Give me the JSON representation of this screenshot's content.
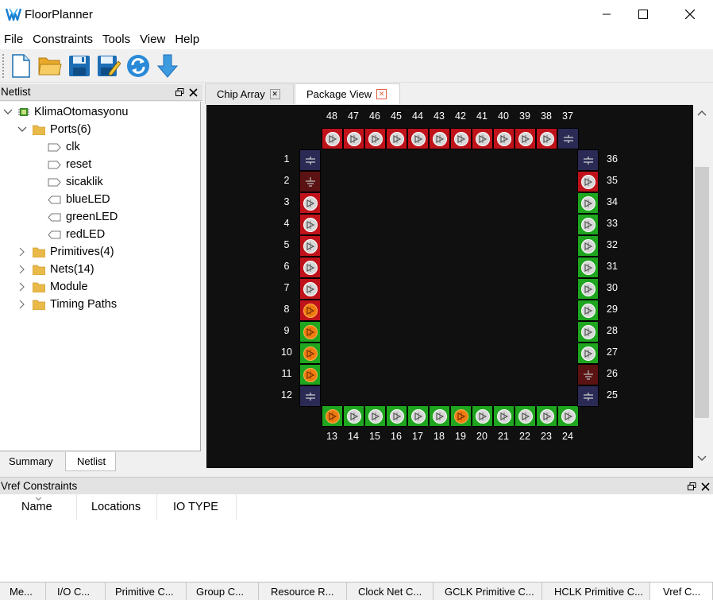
{
  "window": {
    "title": "FloorPlanner",
    "minimize_icon": "minimize-icon",
    "maximize_icon": "maximize-icon",
    "close_icon": "close-icon"
  },
  "menu": [
    "File",
    "Constraints",
    "Tools",
    "View",
    "Help"
  ],
  "toolbar": [
    {
      "name": "new-file-icon"
    },
    {
      "name": "open-folder-icon"
    },
    {
      "name": "save-icon"
    },
    {
      "name": "save-as-icon"
    },
    {
      "name": "refresh-icon"
    },
    {
      "name": "download-arrow-icon"
    }
  ],
  "netlist_panel": {
    "title": "Netlist",
    "root": "KlimaOtomasyonu",
    "ports_label": "Ports(6)",
    "ports": [
      "clk",
      "reset",
      "sicaklik",
      "blueLED",
      "greenLED",
      "redLED"
    ],
    "groups": [
      "Primitives(4)",
      "Nets(14)",
      "Module",
      "Timing Paths"
    ],
    "tabs": [
      "Summary",
      "Netlist"
    ]
  },
  "editor_tabs": [
    "Chip Array",
    "Package View"
  ],
  "package": {
    "top_pins": [
      {
        "num": "48",
        "type": "io",
        "color": "#c0121a"
      },
      {
        "num": "47",
        "type": "io",
        "color": "#c0121a"
      },
      {
        "num": "46",
        "type": "io",
        "color": "#c0121a"
      },
      {
        "num": "45",
        "type": "io",
        "color": "#c0121a"
      },
      {
        "num": "44",
        "type": "io",
        "color": "#c0121a"
      },
      {
        "num": "43",
        "type": "io",
        "color": "#c0121a"
      },
      {
        "num": "42",
        "type": "io",
        "color": "#c0121a"
      },
      {
        "num": "41",
        "type": "io",
        "color": "#c0121a"
      },
      {
        "num": "40",
        "type": "io",
        "color": "#c0121a"
      },
      {
        "num": "39",
        "type": "io",
        "color": "#c0121a"
      },
      {
        "num": "38",
        "type": "io",
        "color": "#c0121a"
      },
      {
        "num": "37",
        "type": "vcc",
        "color": "#2a2a55"
      }
    ],
    "left_pins": [
      {
        "num": "1",
        "type": "vcc",
        "color": "#2a2a55"
      },
      {
        "num": "2",
        "type": "gnd",
        "color": "#5a1212"
      },
      {
        "num": "3",
        "type": "io",
        "color": "#c0121a"
      },
      {
        "num": "4",
        "type": "io",
        "color": "#c0121a"
      },
      {
        "num": "5",
        "type": "io",
        "color": "#c0121a"
      },
      {
        "num": "6",
        "type": "io",
        "color": "#c0121a"
      },
      {
        "num": "7",
        "type": "io",
        "color": "#c0121a"
      },
      {
        "num": "8",
        "type": "io-used",
        "color": "#c0121a"
      },
      {
        "num": "9",
        "type": "io-used",
        "color": "#1fa51f"
      },
      {
        "num": "10",
        "type": "io-used",
        "color": "#1fa51f"
      },
      {
        "num": "11",
        "type": "io-used",
        "color": "#1fa51f"
      },
      {
        "num": "12",
        "type": "vcc",
        "color": "#2a2a55"
      }
    ],
    "bottom_pins": [
      {
        "num": "13",
        "type": "io-used",
        "color": "#1fa51f"
      },
      {
        "num": "14",
        "type": "io",
        "color": "#1fa51f"
      },
      {
        "num": "15",
        "type": "io",
        "color": "#1fa51f"
      },
      {
        "num": "16",
        "type": "io",
        "color": "#1fa51f"
      },
      {
        "num": "17",
        "type": "io",
        "color": "#1fa51f"
      },
      {
        "num": "18",
        "type": "io",
        "color": "#1fa51f"
      },
      {
        "num": "19",
        "type": "io-used",
        "color": "#1fa51f"
      },
      {
        "num": "20",
        "type": "io",
        "color": "#1fa51f"
      },
      {
        "num": "21",
        "type": "io",
        "color": "#1fa51f"
      },
      {
        "num": "22",
        "type": "io",
        "color": "#1fa51f"
      },
      {
        "num": "23",
        "type": "io",
        "color": "#1fa51f"
      },
      {
        "num": "24",
        "type": "io",
        "color": "#1fa51f"
      }
    ],
    "right_pins": [
      {
        "num": "36",
        "type": "vcc",
        "color": "#2a2a55"
      },
      {
        "num": "35",
        "type": "io",
        "color": "#c0121a"
      },
      {
        "num": "34",
        "type": "io",
        "color": "#1fa51f"
      },
      {
        "num": "33",
        "type": "io",
        "color": "#1fa51f"
      },
      {
        "num": "32",
        "type": "io",
        "color": "#1fa51f"
      },
      {
        "num": "31",
        "type": "io",
        "color": "#1fa51f"
      },
      {
        "num": "30",
        "type": "io",
        "color": "#1fa51f"
      },
      {
        "num": "29",
        "type": "io",
        "color": "#1fa51f"
      },
      {
        "num": "28",
        "type": "io",
        "color": "#1fa51f"
      },
      {
        "num": "27",
        "type": "io",
        "color": "#1fa51f"
      },
      {
        "num": "26",
        "type": "gnd",
        "color": "#5a1212"
      },
      {
        "num": "25",
        "type": "vcc",
        "color": "#2a2a55"
      }
    ]
  },
  "vref_panel": {
    "title": "Vref Constraints",
    "columns": [
      "Name",
      "Locations",
      "IO TYPE"
    ]
  },
  "bottom_tabs": [
    "Me...",
    "I/O C...",
    "Primitive C...",
    "Group C...",
    "Resource R...",
    "Clock Net C...",
    "GCLK Primitive C...",
    "HCLK Primitive C...",
    "Vref C..."
  ]
}
